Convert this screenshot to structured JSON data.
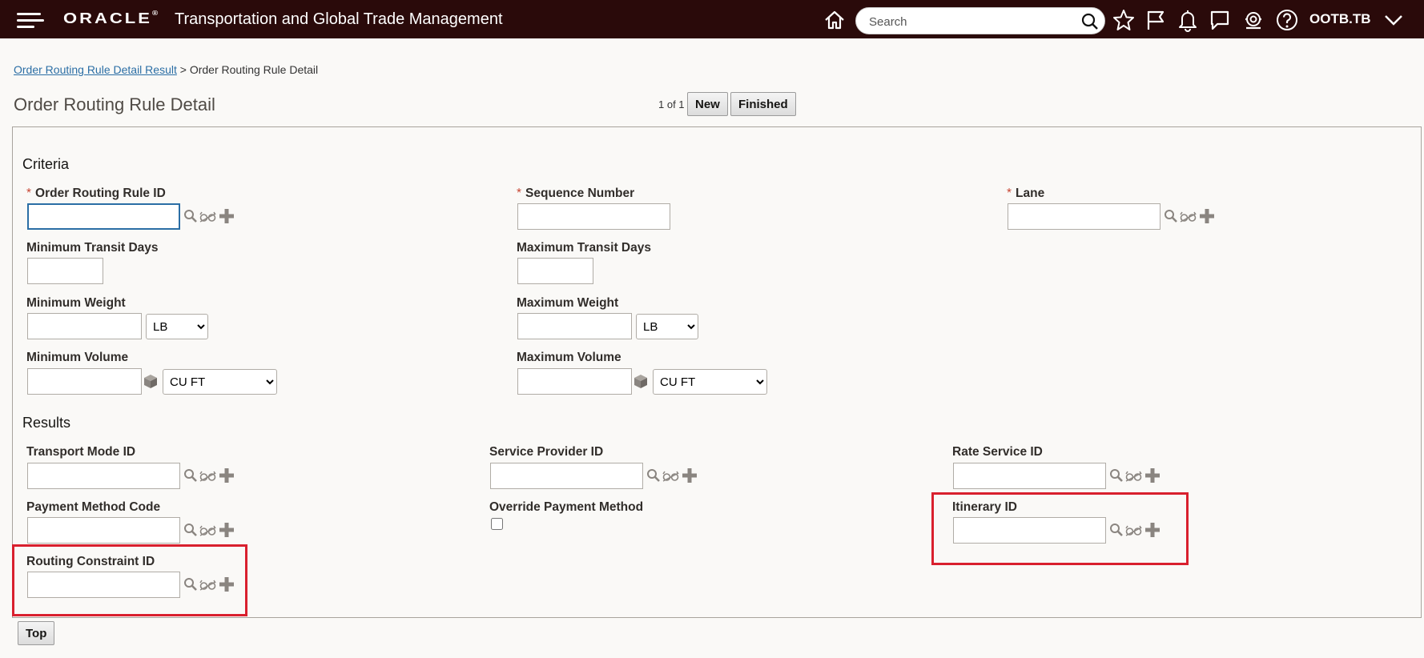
{
  "header": {
    "brand": "ORACLE",
    "brand_mark": "®",
    "app_title": "Transportation and Global Trade Management",
    "search_placeholder": "Search",
    "user": "OOTB.TB",
    "colors": {
      "bar": "#2a0a0a",
      "link": "#2b6ea5",
      "required": "#c74634",
      "highlight": "#d9202e"
    }
  },
  "breadcrumb": {
    "link": "Order Routing Rule Detail Result",
    "separator": ">",
    "current": "Order Routing Rule Detail"
  },
  "page": {
    "title": "Order Routing Rule Detail",
    "pager": "1 of 1",
    "new_label": "New",
    "finished_label": "Finished",
    "top_label": "Top"
  },
  "criteria": {
    "heading": "Criteria",
    "required_mark": "*",
    "order_routing_rule_id": {
      "label": "Order Routing Rule ID",
      "value": ""
    },
    "sequence_number": {
      "label": "Sequence Number",
      "value": ""
    },
    "lane": {
      "label": "Lane",
      "value": ""
    },
    "min_transit_days": {
      "label": "Minimum Transit Days",
      "value": ""
    },
    "max_transit_days": {
      "label": "Maximum Transit Days",
      "value": ""
    },
    "min_weight": {
      "label": "Minimum Weight",
      "value": "",
      "uom": "LB"
    },
    "max_weight": {
      "label": "Maximum Weight",
      "value": "",
      "uom": "LB"
    },
    "min_volume": {
      "label": "Minimum Volume",
      "value": "",
      "uom": "CU FT"
    },
    "max_volume": {
      "label": "Maximum Volume",
      "value": "",
      "uom": "CU FT"
    }
  },
  "results": {
    "heading": "Results",
    "transport_mode_id": {
      "label": "Transport Mode ID",
      "value": ""
    },
    "service_provider_id": {
      "label": "Service Provider ID",
      "value": ""
    },
    "rate_service_id": {
      "label": "Rate Service ID",
      "value": ""
    },
    "payment_method_code": {
      "label": "Payment Method Code",
      "value": ""
    },
    "override_payment_method": {
      "label": "Override Payment Method",
      "checked": false
    },
    "itinerary_id": {
      "label": "Itinerary ID",
      "value": ""
    },
    "routing_constraint_id": {
      "label": "Routing Constraint ID",
      "value": ""
    }
  },
  "icons": [
    "hamburger-icon",
    "home-icon",
    "search-icon",
    "star-icon",
    "flag-icon",
    "bell-icon",
    "chat-icon",
    "support-icon",
    "help-icon",
    "chevron-down-icon",
    "lookup-icon",
    "view-icon",
    "add-icon",
    "volume-cube-icon"
  ]
}
